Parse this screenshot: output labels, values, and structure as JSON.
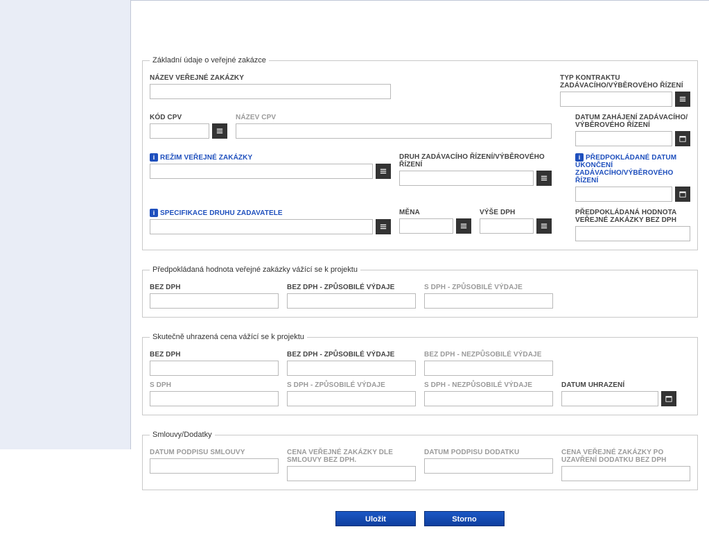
{
  "fs1": {
    "legend": "Základní údaje o veřejné zakázce",
    "nazev_zakazky": "NÁZEV VEŘEJNÉ ZAKÁZKY",
    "typ_kontraktu": "TYP KONTRAKTU ZADÁVACÍHO/VÝBĚROVÉHO ŘÍZENÍ",
    "kod_cpv": "KÓD CPV",
    "nazev_cpv": "NÁZEV CPV",
    "datum_zahajeni": "DATUM ZAHÁJENÍ ZADÁVACÍHO/ VÝBĚROVÉHO ŘÍZENÍ",
    "rezim": "REŽIM VEŘEJNÉ ZAKÁZKY",
    "druh_rizeni": "DRUH ZADÁVACÍHO ŘÍZENÍ/VÝBĚROVÉHO ŘÍZENÍ",
    "datum_ukonceni": "PŘEDPOKLÁDANÉ DATUM UKONČENÍ ZADÁVACÍHO/VÝBĚROVÉHO ŘÍZENÍ",
    "spec_druhu": "SPECIFIKACE DRUHU ZADAVATELE",
    "mena": "MĚNA",
    "vyse_dph": "VÝŠE DPH",
    "hodnota_bez_dph": "PŘEDPOKLÁDANÁ HODNOTA VEŘEJNÉ ZAKÁZKY BEZ DPH"
  },
  "fs2": {
    "legend": "Předpokládaná hodnota veřejné zakázky vážící se k projektu",
    "bez_dph": "BEZ DPH",
    "bez_dph_zp": "BEZ DPH - ZPŮSOBILÉ VÝDAJE",
    "s_dph_zp": "S DPH - ZPŮSOBILÉ VÝDAJE"
  },
  "fs3": {
    "legend": "Skutečně uhrazená cena vážící se k projektu",
    "bez_dph": "BEZ DPH",
    "bez_dph_zp": "BEZ DPH - ZPŮSOBILÉ VÝDAJE",
    "bez_dph_nzp": "BEZ DPH - NEZPŮSOBILÉ VÝDAJE",
    "s_dph": "S DPH",
    "s_dph_zp": "S DPH - ZPŮSOBILÉ VÝDAJE",
    "s_dph_nzp": "S DPH - NEZPŮSOBILÉ VÝDAJE",
    "datum_uhrazeni": "DATUM UHRAZENÍ"
  },
  "fs4": {
    "legend": "Smlouvy/Dodatky",
    "datum_podpisu_sml": "DATUM PODPISU SMLOUVY",
    "cena_dle_sml": "CENA VEŘEJNÉ ZAKÁZKY DLE SMLOUVY BEZ DPH.",
    "datum_podpisu_dod": "DATUM PODPISU DODATKU",
    "cena_po_dod": "CENA VEŘEJNÉ ZAKÁZKY PO UZAVŘENÍ DODATKU BEZ DPH"
  },
  "buttons": {
    "save": "Uložit",
    "cancel": "Storno"
  }
}
